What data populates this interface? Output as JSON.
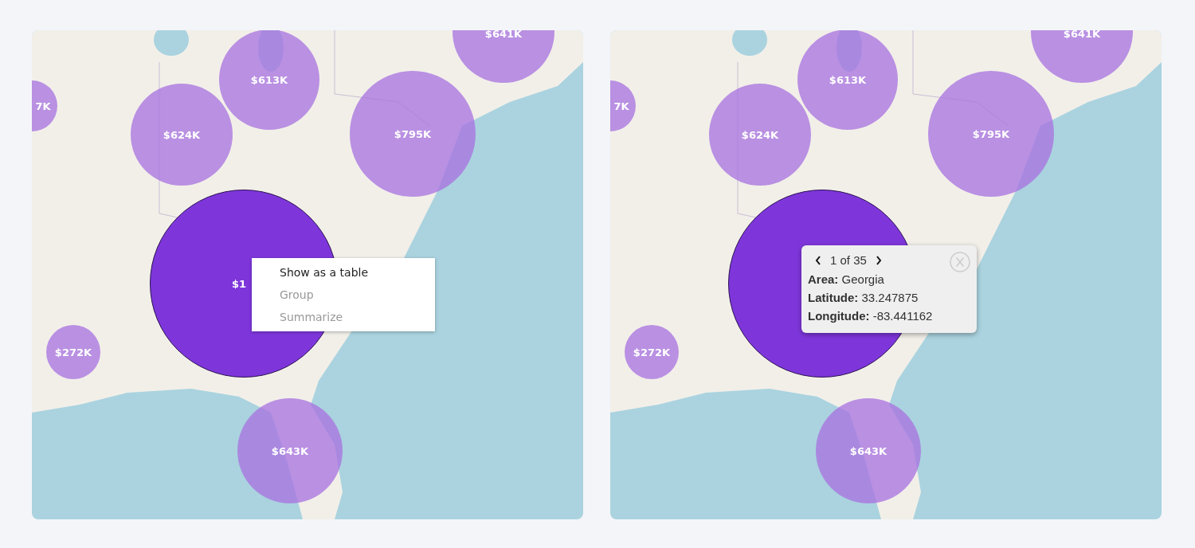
{
  "maps": [
    {
      "bubbles": [
        {
          "label": "7K",
          "selected": false
        },
        {
          "label": "$613K",
          "selected": false
        },
        {
          "label": "$624K",
          "selected": false
        },
        {
          "label": "$641K",
          "selected": false
        },
        {
          "label": "$795K",
          "selected": false
        },
        {
          "label": "$1",
          "selected": true
        },
        {
          "label": "$272K",
          "selected": false
        },
        {
          "label": "$643K",
          "selected": false
        }
      ],
      "context_menu": {
        "items": [
          {
            "label": "Show as a table",
            "disabled": false
          },
          {
            "label": "Group",
            "disabled": true
          },
          {
            "label": "Summarize",
            "disabled": true
          }
        ]
      }
    },
    {
      "bubbles": [
        {
          "label": "7K",
          "selected": false
        },
        {
          "label": "$613K",
          "selected": false
        },
        {
          "label": "$624K",
          "selected": false
        },
        {
          "label": "$641K",
          "selected": false
        },
        {
          "label": "$795K",
          "selected": false
        },
        {
          "selected": true
        },
        {
          "label": "$272K",
          "selected": false
        },
        {
          "label": "$643K",
          "selected": false
        }
      ],
      "popup": {
        "pager": "1 of 35",
        "fields": [
          {
            "label": "Area:",
            "value": "Georgia"
          },
          {
            "label": "Latitude:",
            "value": "33.247875"
          },
          {
            "label": "Longitude:",
            "value": "-83.441162"
          }
        ]
      }
    }
  ]
}
